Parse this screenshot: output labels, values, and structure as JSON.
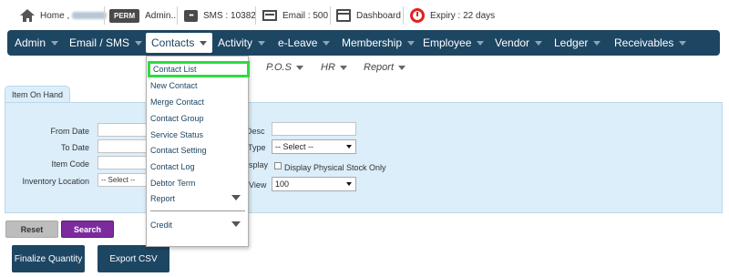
{
  "topbar": {
    "home_label": "Home ,",
    "perm_badge": "PERM",
    "admin_label": "Admin...",
    "sms_label": "SMS : 10382",
    "email_label": "Email : 500",
    "dashboard_label": "Dashboard",
    "expiry_label": "Expiry : 22 days"
  },
  "nav": {
    "items": [
      "Admin",
      "Email / SMS",
      "Contacts",
      "Activity",
      "e-Leave",
      "Membership",
      "Employee",
      "Vendor",
      "Ledger",
      "Receivables"
    ]
  },
  "subnav": {
    "items": [
      "P.O.S",
      "HR",
      "Report"
    ]
  },
  "tab": {
    "label": "Item On Hand"
  },
  "form": {
    "from_date_label": "From Date",
    "to_date_label": "To Date",
    "item_code_label": "Item Code",
    "inventory_location_label": "Inventory Location",
    "inventory_location_value": "-- Select --",
    "desc_label": "Desc",
    "type_label": "Type",
    "type_value": "-- Select --",
    "display_label": "splay",
    "display_checkbox_label": "Display Physical Stock Only",
    "view_label": "View",
    "view_value": "100"
  },
  "buttons": {
    "reset": "Reset",
    "search": "Search",
    "finalize_quantity": "Finalize Quantity",
    "export_csv": "Export CSV"
  },
  "dropdown": {
    "items": [
      "Contact List",
      "New Contact",
      "Merge Contact",
      "Contact Group",
      "Service Status",
      "Contact Setting",
      "Contact Log",
      "Debtor Term",
      "Report",
      "Credit"
    ],
    "highlight_color": "#2edb3e"
  },
  "colors": {
    "nav_bg": "#1d4663",
    "panel_bg": "#dbeefa",
    "search_btn": "#7b2b9e",
    "expiry_icon": "#e02222"
  }
}
